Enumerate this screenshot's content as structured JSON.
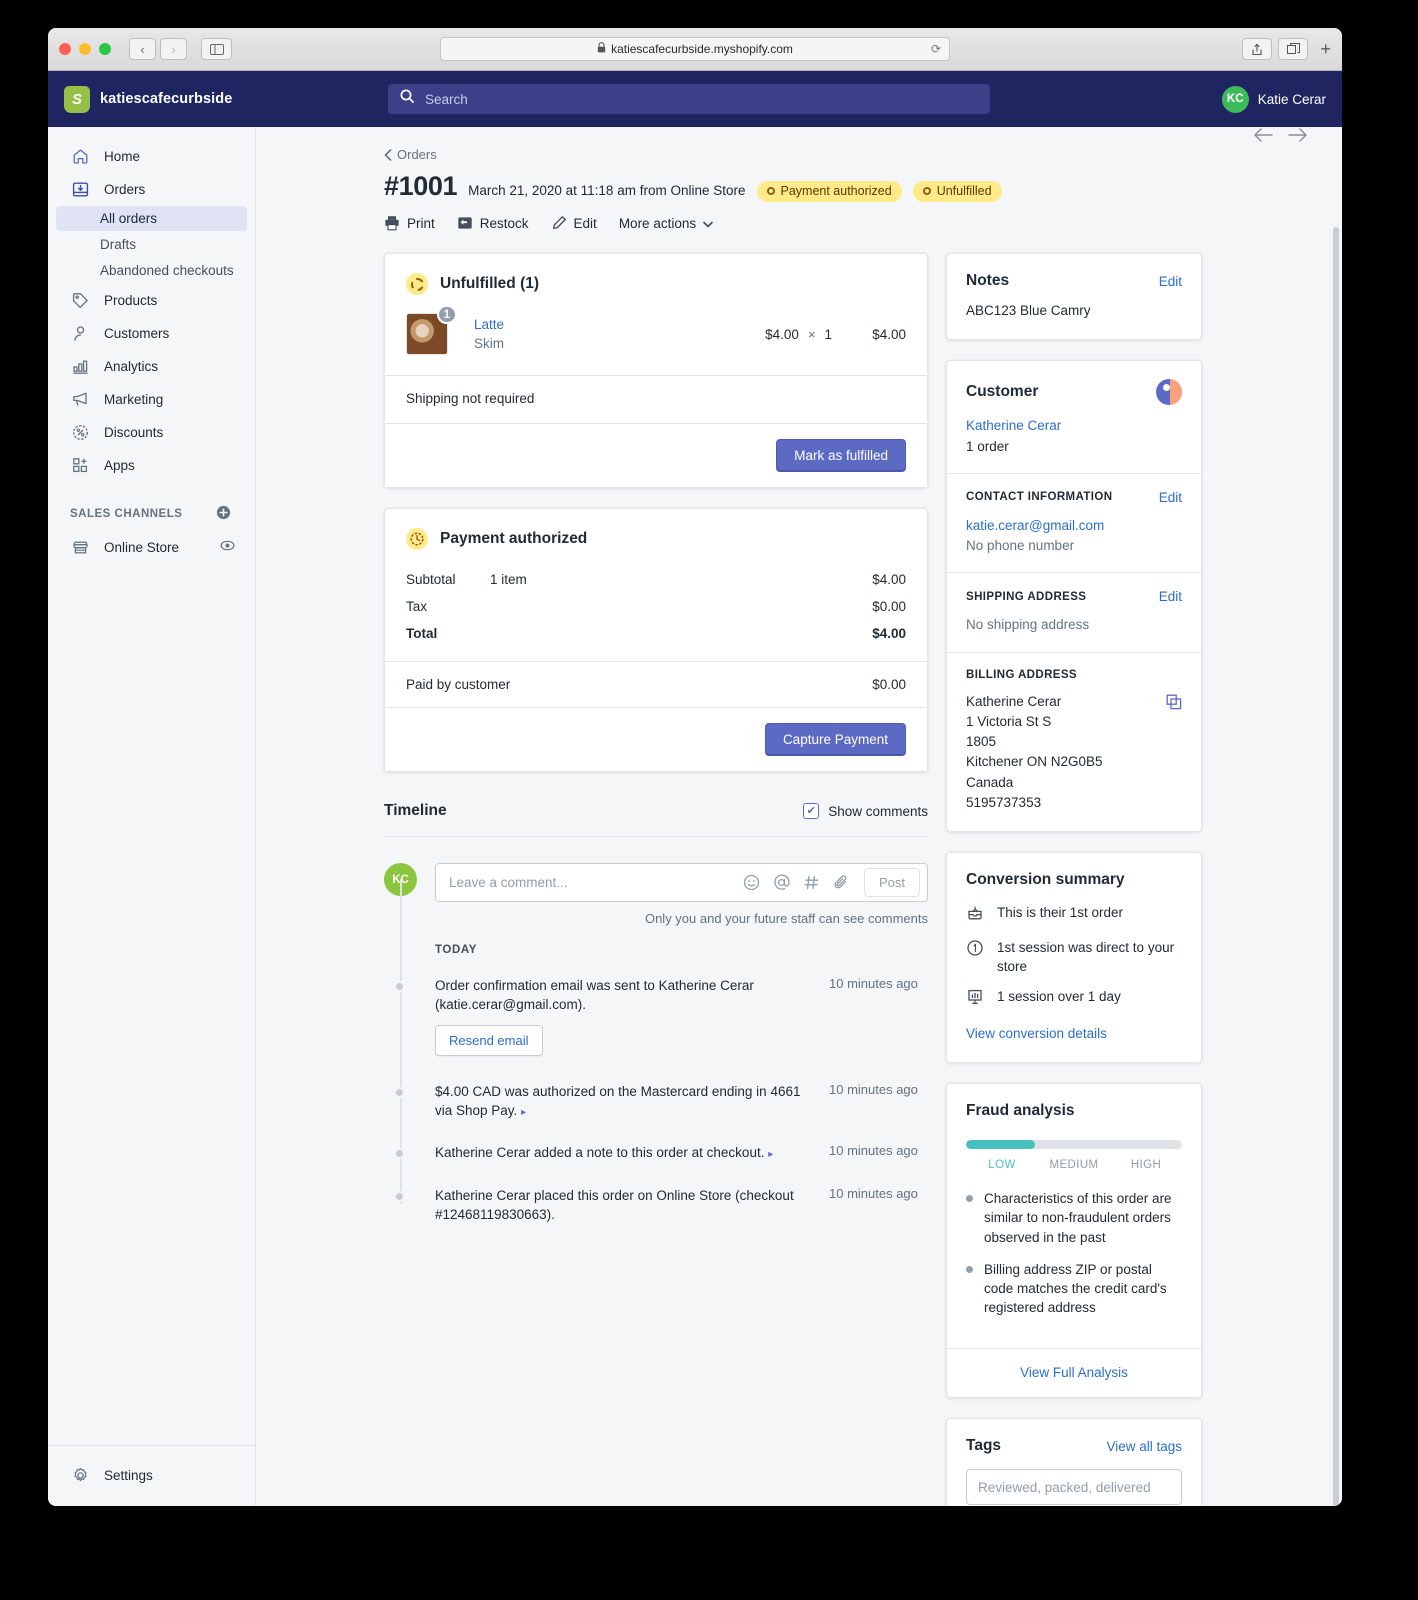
{
  "browser": {
    "url": "katiescafecurbside.myshopify.com",
    "lock_icon": "lock-icon",
    "reload_icon": "reload-icon",
    "back_icon": "chevron-left-icon",
    "forward_icon": "chevron-right-icon",
    "sidebar_icon": "sidebar-toggle-icon",
    "share_icon": "share-icon",
    "tabs_icon": "tab-overview-icon",
    "new_tab_label": "+"
  },
  "topbar": {
    "brand": "katiescafecurbside",
    "search_placeholder": "Search",
    "user_initials": "KC",
    "user_name": "Katie Cerar"
  },
  "sidebar": {
    "items": [
      {
        "label": "Home",
        "icon": "home-icon"
      },
      {
        "label": "Orders",
        "icon": "orders-icon"
      },
      {
        "label": "Products",
        "icon": "tag-icon"
      },
      {
        "label": "Customers",
        "icon": "person-icon"
      },
      {
        "label": "Analytics",
        "icon": "bar-chart-icon"
      },
      {
        "label": "Marketing",
        "icon": "megaphone-icon"
      },
      {
        "label": "Discounts",
        "icon": "discount-icon"
      },
      {
        "label": "Apps",
        "icon": "apps-icon"
      }
    ],
    "order_subitems": [
      {
        "label": "All orders",
        "active": true
      },
      {
        "label": "Drafts",
        "active": false
      },
      {
        "label": "Abandoned checkouts",
        "active": false
      }
    ],
    "sales_channels_label": "SALES CHANNELS",
    "add_channel_icon": "plus-circle-icon",
    "online_store": {
      "label": "Online Store",
      "icon": "store-icon",
      "action_icon": "eye-icon"
    },
    "settings": {
      "label": "Settings",
      "icon": "gear-icon"
    }
  },
  "page": {
    "breadcrumb": "Orders",
    "order_number": "#1001",
    "order_meta": "March 21, 2020 at 11:18 am from Online Store",
    "badges": [
      {
        "label": "Payment authorized"
      },
      {
        "label": "Unfulfilled"
      }
    ],
    "actions": [
      {
        "label": "Print",
        "icon": "printer-icon"
      },
      {
        "label": "Restock",
        "icon": "restock-icon"
      },
      {
        "label": "Edit",
        "icon": "pencil-icon"
      },
      {
        "label": "More actions",
        "icon": "chevron-down-icon"
      }
    ],
    "prev_icon": "arrow-left-icon",
    "next_icon": "arrow-right-icon"
  },
  "fulfillment": {
    "title": "Unfulfilled (1)",
    "status_icon": "dashed-circle-icon",
    "item": {
      "qty_badge": "1",
      "name": "Latte",
      "variant": "Skim",
      "unit_price": "$4.00",
      "times": "×",
      "quantity": "1",
      "line_total": "$4.00"
    },
    "shipping_note": "Shipping not required",
    "primary_button": "Mark as fulfilled"
  },
  "payment": {
    "title": "Payment authorized",
    "status_icon": "clock-icon",
    "rows": [
      {
        "label": "Subtotal",
        "sub": "1 item",
        "amount": "$4.00",
        "bold": false
      },
      {
        "label": "Tax",
        "sub": "",
        "amount": "$0.00",
        "bold": false
      },
      {
        "label": "Total",
        "sub": "",
        "amount": "$4.00",
        "bold": true
      }
    ],
    "paid_label": "Paid by customer",
    "paid_amount": "$0.00",
    "primary_button": "Capture Payment"
  },
  "timeline": {
    "title": "Timeline",
    "show_comments_label": "Show comments",
    "show_comments_checked": true,
    "composer": {
      "avatar_initials": "KC",
      "placeholder": "Leave a comment...",
      "post_label": "Post",
      "hint": "Only you and your future staff can see comments",
      "icons": [
        "emoji-icon",
        "mention-icon",
        "hashtag-icon",
        "attachment-icon"
      ]
    },
    "day_label": "TODAY",
    "events": [
      {
        "text": "Order confirmation email was sent to Katherine Cerar (katie.cerar@gmail.com).",
        "time": "10 minutes ago",
        "button": "Resend email"
      },
      {
        "text": "$4.00 CAD was authorized on the Mastercard ending in 4661 via Shop Pay.",
        "time": "10 minutes ago",
        "caret": "▸"
      },
      {
        "text": "Katherine Cerar added a note to this order at checkout.",
        "time": "10 minutes ago",
        "caret": "▸"
      },
      {
        "text": "Katherine Cerar placed this order on Online Store (checkout #12468119830663).",
        "time": "10 minutes ago"
      }
    ]
  },
  "notes": {
    "title": "Notes",
    "edit_label": "Edit",
    "body": "ABC123 Blue Camry"
  },
  "customer": {
    "title": "Customer",
    "avatar_icon": "customer-avatar-icon",
    "name": "Katherine Cerar",
    "order_count": "1 order",
    "contact_heading": "CONTACT INFORMATION",
    "contact_edit": "Edit",
    "email": "katie.cerar@gmail.com",
    "phone": "No phone number",
    "shipping_heading": "SHIPPING ADDRESS",
    "shipping_edit": "Edit",
    "shipping_value": "No shipping address",
    "billing_heading": "BILLING ADDRESS",
    "billing_lines": [
      "Katherine Cerar",
      "1 Victoria St S",
      "1805",
      "Kitchener ON N2G0B5",
      "Canada",
      "5195737353"
    ],
    "copy_icon": "copy-icon"
  },
  "conversion": {
    "title": "Conversion summary",
    "rows": [
      {
        "text": "This is their 1st order",
        "icon": "first-order-icon"
      },
      {
        "text": "1st session was direct to your store",
        "icon": "session-icon"
      },
      {
        "text": "1 session over 1 day",
        "icon": "chart-icon"
      }
    ],
    "link": "View conversion details"
  },
  "fraud": {
    "title": "Fraud analysis",
    "level": "LOW",
    "levels": [
      "LOW",
      "MEDIUM",
      "HIGH"
    ],
    "bar_fill_percent": 32,
    "bar_color": "#47c1bf",
    "items": [
      "Characteristics of this order are similar to non-fraudulent orders observed in the past",
      "Billing address ZIP or postal code matches the credit card's registered address"
    ],
    "footer_link": "View Full Analysis"
  },
  "tags": {
    "title": "Tags",
    "view_all": "View all tags",
    "placeholder": "Reviewed, packed, delivered",
    "value": ""
  }
}
